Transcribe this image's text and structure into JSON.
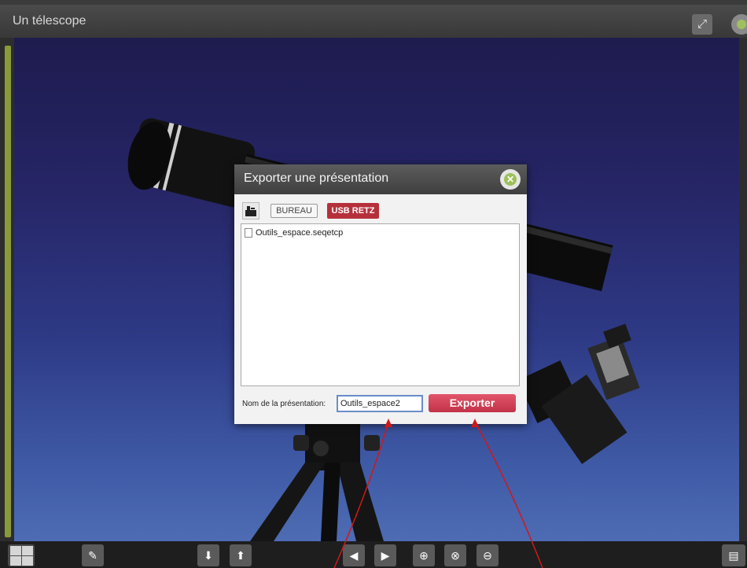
{
  "window": {
    "title": "Un télescope"
  },
  "dialog": {
    "title": "Exporter une présentation",
    "locations": [
      "BUREAU",
      "USB RETZ"
    ],
    "files": [
      "Outils_espace.seqetcp"
    ],
    "name_label": "Nom de la présentation:",
    "name_value": "Outils_espace2",
    "export_label": "Exporter"
  },
  "colors": {
    "accent": "#b6303b",
    "close_green": "#9cc05a"
  },
  "icons": {
    "drive": "drive-icon",
    "grid": "grid-icon",
    "pen": "pen-icon",
    "import": "import-icon",
    "export": "export-icon",
    "prev": "prev-icon",
    "next": "next-icon",
    "zoom_in": "zoom-in-icon",
    "zoom_reset": "zoom-reset-icon",
    "zoom_out": "zoom-out-icon",
    "document": "document-icon"
  }
}
